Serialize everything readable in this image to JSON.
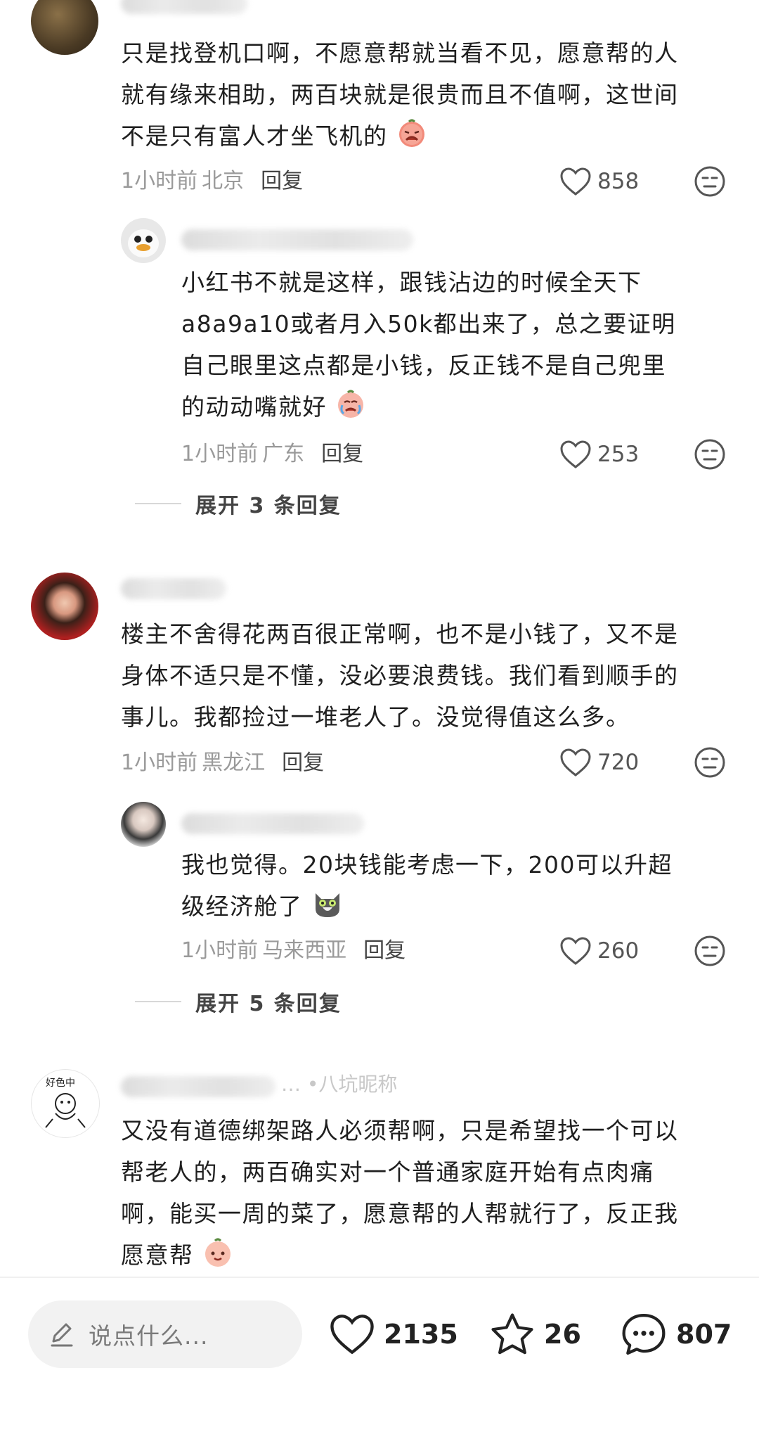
{
  "comments": [
    {
      "text_lines": [
        "只是找登机口啊，不愿意帮就当看不见，愿意帮的人",
        "就有缘来相助，两百块就是很贵而且不值啊，这世间",
        "不是只有富人才坐飞机的"
      ],
      "emoji": "tired-face",
      "time": "1小时前",
      "location": "北京",
      "reply_label": "回复",
      "likes": "858"
    },
    {
      "text_lines": [
        "小红书不就是这样，跟钱沾边的时候全天下",
        "a8a9a10或者月入50k都出来了，总之要证明",
        "自己眼里这点都是小钱，反正钱不是自己兜里",
        "的动动嘴就好"
      ],
      "emoji": "crying-face",
      "time": "1小时前",
      "location": "广东",
      "reply_label": "回复",
      "likes": "253"
    },
    {
      "text_lines": [
        "楼主不舍得花两百很正常啊，也不是小钱了，又不是",
        "身体不适只是不懂，没必要浪费钱。我们看到顺手的",
        "事儿。我都捡过一堆老人了。没觉得值这么多。"
      ],
      "time": "1小时前",
      "location": "黑龙江",
      "reply_label": "回复",
      "likes": "720"
    },
    {
      "text_lines": [
        "我也觉得。20块钱能考虑一下，200可以升超",
        "级经济舱了"
      ],
      "emoji": "cat-face",
      "time": "1小时前",
      "location": "马来西亚",
      "reply_label": "回复",
      "likes": "260"
    },
    {
      "name_visible": "… •八坑昵称",
      "avatar_text": "好色中",
      "text_lines": [
        "又没有道德绑架路人必须帮啊，只是希望找一个可以",
        "帮老人的，两百确实对一个普通家庭开始有点肉痛",
        "啊，能买一周的菜了，愿意帮的人帮就行了，反正我",
        "愿意帮"
      ],
      "emoji": "peach-face"
    }
  ],
  "expand_1": "展开 3 条回复",
  "expand_2": "展开 5 条回复",
  "bottom": {
    "input_placeholder": "说点什么...",
    "likes": "2135",
    "favorites": "26",
    "comments": "807"
  },
  "icons": [
    "heart-icon",
    "dislike-icon",
    "pencil-icon",
    "star-icon",
    "chat-icon"
  ],
  "colors": {
    "text": "#1f1f1f",
    "meta": "#9a9a9a",
    "reply": "#444444"
  }
}
